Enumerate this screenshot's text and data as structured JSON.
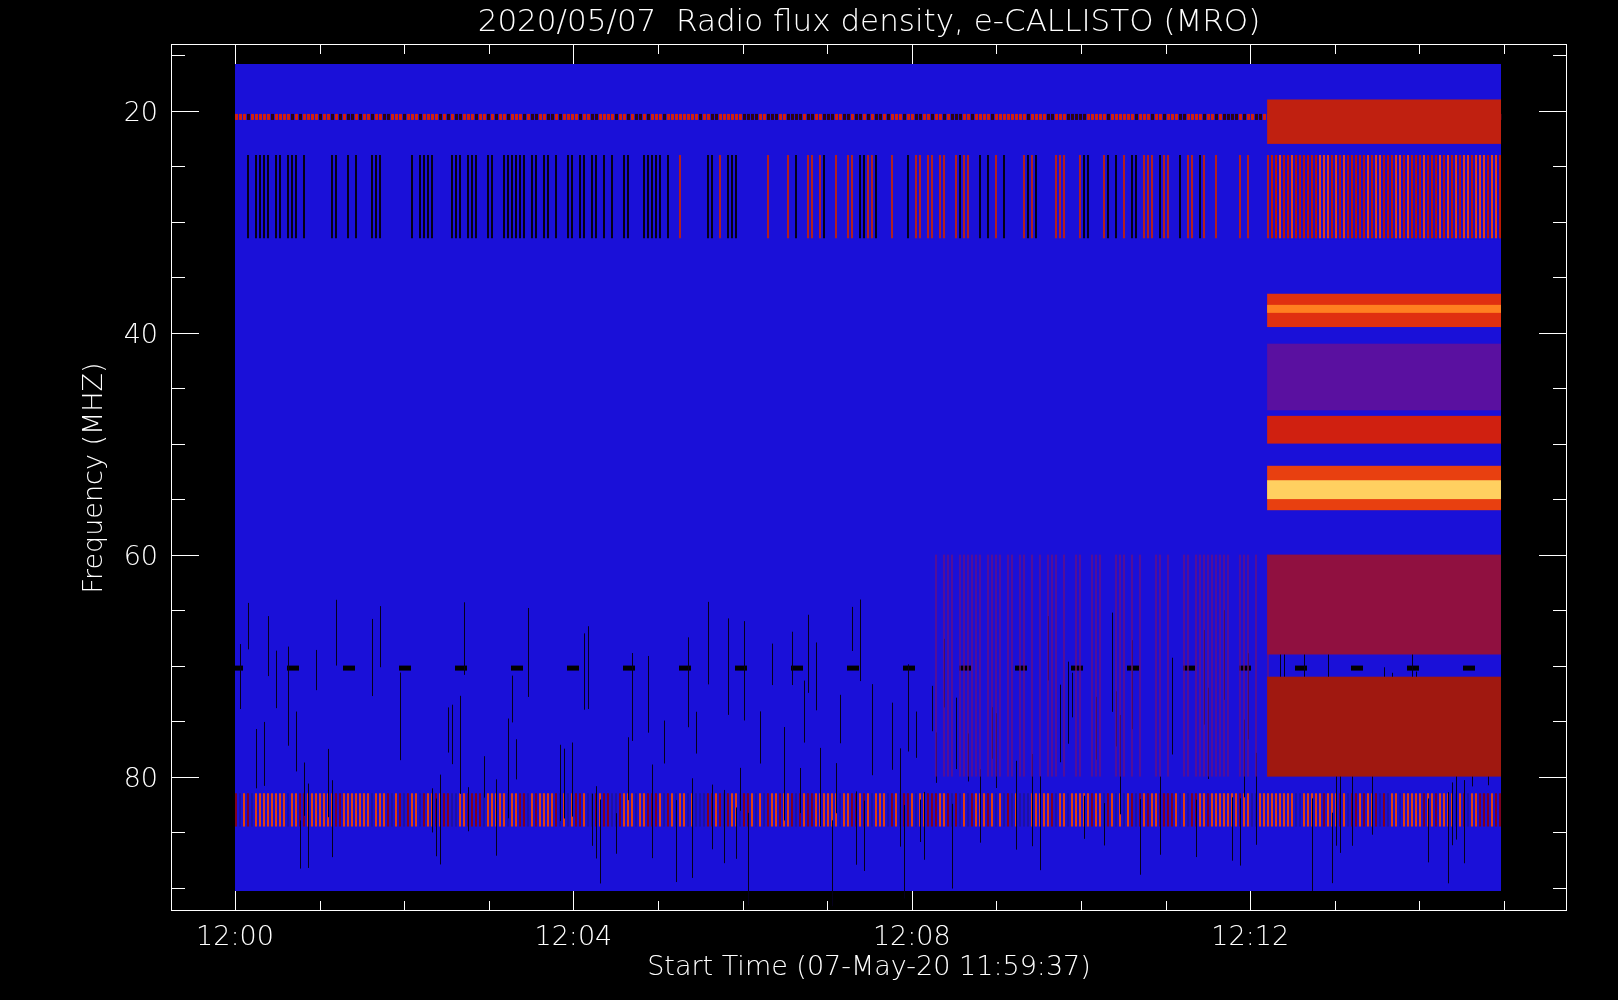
{
  "plot": {
    "title": "2020/05/07  Radio flux density, e-CALLISTO (MRO)",
    "xlabel": "Start Time (07-May-20 11:59:37)",
    "ylabel": "Frequency (MHZ)",
    "x_tick_labels": [
      "12:00",
      "12:04",
      "12:08",
      "12:12"
    ],
    "y_tick_labels": [
      "20",
      "40",
      "60",
      "80"
    ]
  }
}
